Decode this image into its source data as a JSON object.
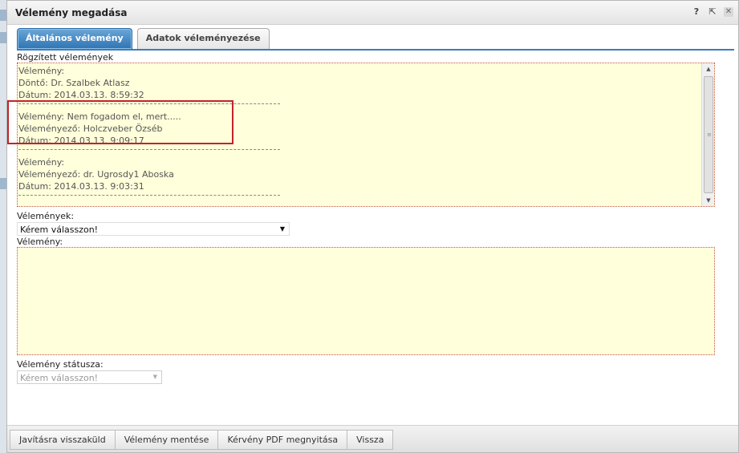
{
  "dialog": {
    "title": "Vélemény megadása",
    "controls": {
      "help": "?",
      "popout": "⇱",
      "close": "✕"
    }
  },
  "tabs": [
    {
      "label": "Általános vélemény",
      "active": true
    },
    {
      "label": "Adatok véleményezése",
      "active": false
    }
  ],
  "history": {
    "label": "Rögzített vélemények",
    "entries": [
      {
        "line1": "Vélemény:",
        "line2": "Döntő: Dr. Szalbek Atlasz",
        "line3": "Dátum: 2014.03.13. 8:59:32"
      },
      {
        "line1": "Vélemény: Nem fogadom el, mert.....",
        "line2": "Véleményező: Holczveber Özséb",
        "line3": "Dátum: 2014.03.13. 9:09:17"
      },
      {
        "line1": "Vélemény:",
        "line2": "Véleményező: dr. Ugrosdy1 Aboska",
        "line3": "Dátum: 2014.03.13. 9:03:31"
      }
    ]
  },
  "opinions_select": {
    "label": "Vélemények:",
    "value": "Kérem válasszon!"
  },
  "opinion_text": {
    "label": "Vélemény:",
    "value": ""
  },
  "status_select": {
    "label": "Vélemény státusza:",
    "value": "Kérem válasszon!"
  },
  "footer": {
    "buttons": [
      "Javításra visszaküld",
      "Vélemény mentése",
      "Kérvény PDF megnyitása",
      "Vissza"
    ]
  },
  "colors": {
    "tab_active": "#2f74b3",
    "field_bg": "#ffffdb",
    "field_border": "#c0504d",
    "highlight": "#c0242a"
  }
}
